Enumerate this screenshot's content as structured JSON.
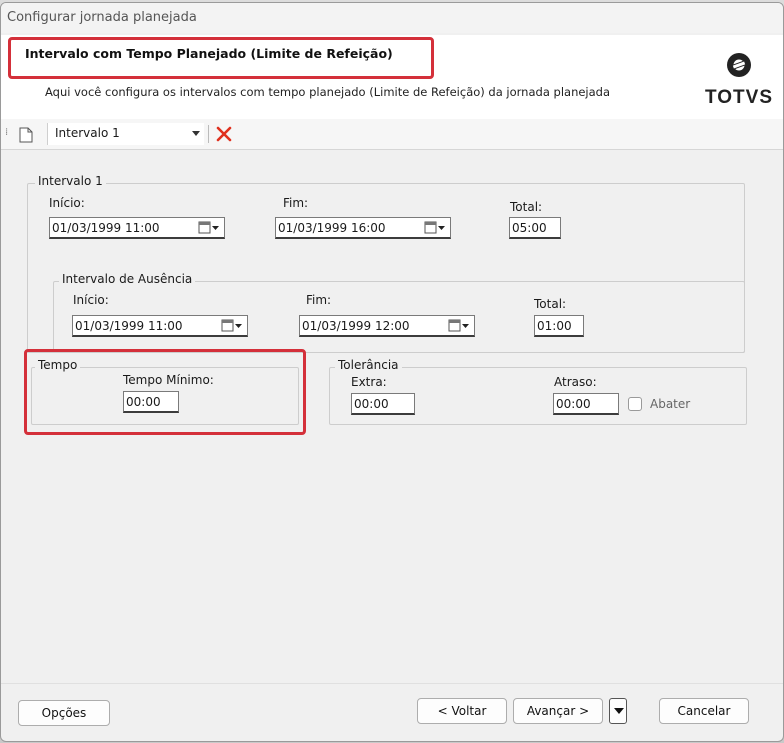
{
  "window": {
    "title": "Configurar jornada planejada"
  },
  "header": {
    "title": "Intervalo com Tempo Planejado (Limite de Refeição)",
    "subtitle": "Aqui você configura os intervalos com tempo planejado (Limite de Refeição) da jornada planejada",
    "logo_text": "TOTVS"
  },
  "toolbar": {
    "selected_interval": "Intervalo 1"
  },
  "intervalo": {
    "group_label": "Intervalo 1",
    "inicio_label": "Início:",
    "inicio_value": "01/03/1999 11:00",
    "fim_label": "Fim:",
    "fim_value": "01/03/1999 16:00",
    "total_label": "Total:",
    "total_value": "05:00"
  },
  "ausencia": {
    "group_label": "Intervalo de Ausência",
    "inicio_label": "Início:",
    "inicio_value": "01/03/1999 11:00",
    "fim_label": "Fim:",
    "fim_value": "01/03/1999 12:00",
    "total_label": "Total:",
    "total_value": "01:00"
  },
  "tempo": {
    "group_label": "Tempo",
    "minimo_label": "Tempo Mínimo:",
    "minimo_value": "00:00"
  },
  "tolerancia": {
    "group_label": "Tolerância",
    "extra_label": "Extra:",
    "extra_value": "00:00",
    "atraso_label": "Atraso:",
    "atraso_value": "00:00",
    "abater_label": "Abater",
    "abater_checked": false
  },
  "footer": {
    "opcoes": "Opções",
    "voltar": "< Voltar",
    "avancar": "Avançar >",
    "cancelar": "Cancelar"
  },
  "colors": {
    "highlight": "#d4303a",
    "delete_icon": "#e0301e"
  }
}
